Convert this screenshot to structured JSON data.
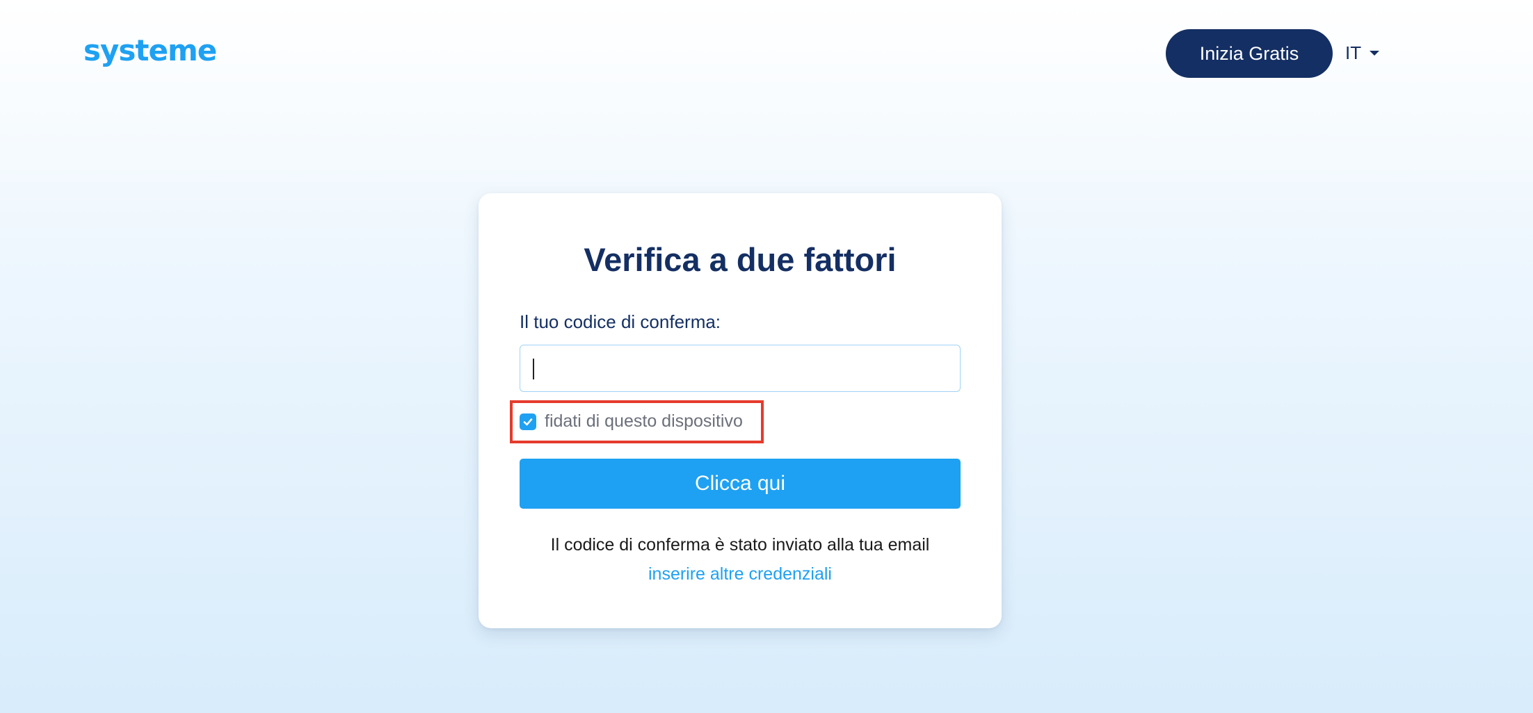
{
  "header": {
    "logo_text": "systeme",
    "start_button_label": "Inizia Gratis",
    "language": "IT"
  },
  "card": {
    "title": "Verifica a due fattori",
    "code_label": "Il tuo codice di conferma:",
    "code_value": "",
    "trust_device_label": "fidati di questo dispositivo",
    "trust_device_checked": true,
    "submit_label": "Clicca qui",
    "info_text": "Il codice di conferma è stato inviato alla tua email",
    "alt_credentials_link": "inserire altre credenziali"
  },
  "colors": {
    "brand_blue": "#1ea1f2",
    "navy": "#142f63",
    "highlight_red": "#e53b2c"
  }
}
